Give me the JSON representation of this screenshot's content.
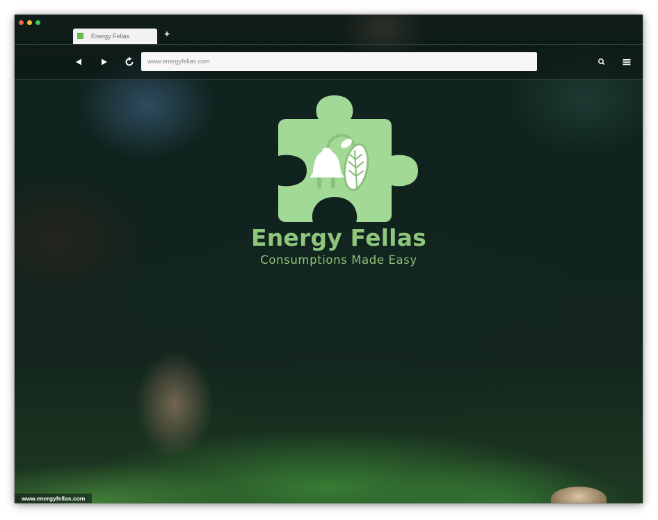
{
  "window": {
    "traffic_lights": [
      {
        "name": "close",
        "color": "#f0604f"
      },
      {
        "name": "minimize",
        "color": "#f5bd3a"
      },
      {
        "name": "zoom",
        "color": "#3fc254"
      }
    ]
  },
  "tab": {
    "title": "Energy Fellas",
    "favicon_color": "#6ab84c",
    "new_tab_label": "+"
  },
  "toolbar": {
    "back_icon": "back-arrow-icon",
    "forward_icon": "forward-arrow-icon",
    "reload_icon": "reload-icon",
    "search_icon": "search-icon",
    "menu_icon": "hamburger-menu-icon",
    "address_value": "www.energyfellas.com"
  },
  "page": {
    "brand_title": "Energy Fellas",
    "tagline": "Consumptions Made Easy",
    "brand_color": "#8ec67b",
    "logo_icon": "puzzle-plug-leaf-logo"
  },
  "status_bar": {
    "url": "www.energyfellas.com"
  }
}
